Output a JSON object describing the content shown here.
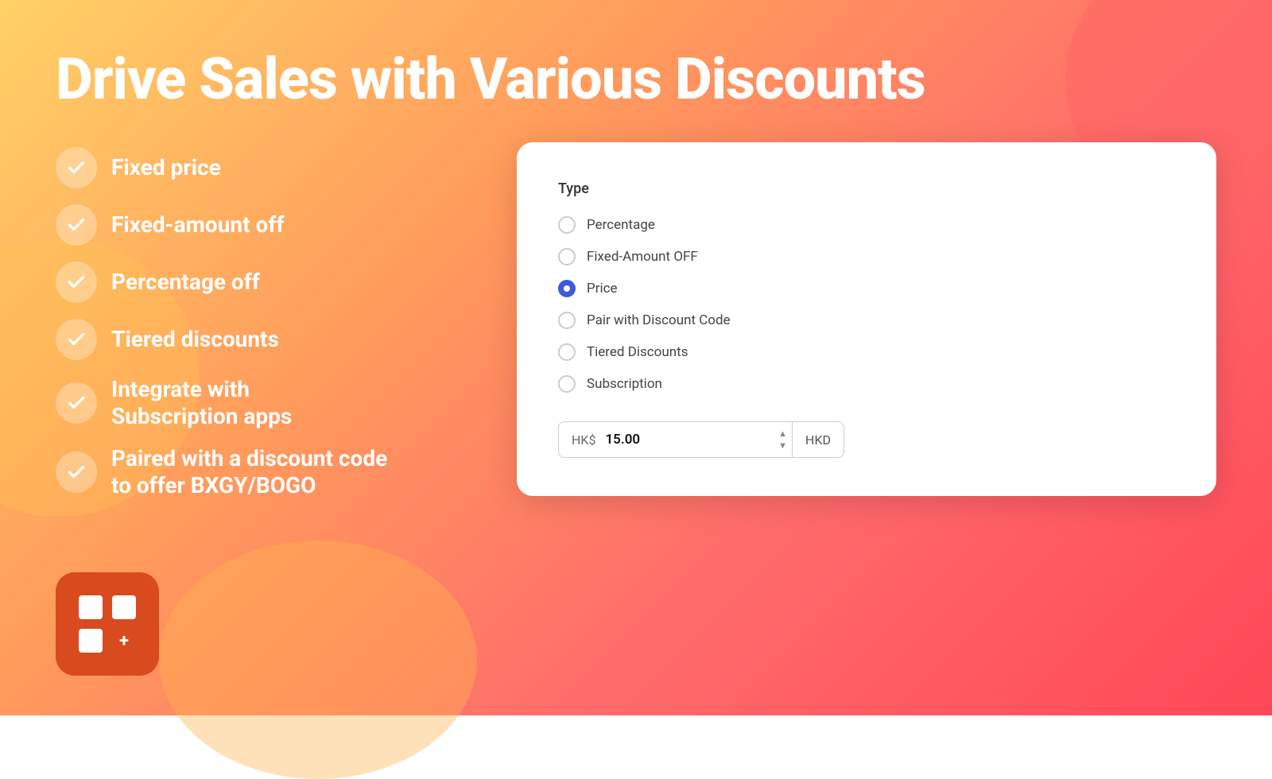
{
  "background": {
    "gradient_start": "#FFD166",
    "gradient_end": "#FF4757"
  },
  "title": "Drive Sales with Various Discounts",
  "checklist": {
    "items": [
      {
        "id": "fixed-price",
        "label": "Fixed price"
      },
      {
        "id": "fixed-amount-off",
        "label": "Fixed-amount off"
      },
      {
        "id": "percentage-off",
        "label": "Percentage off"
      },
      {
        "id": "tiered-discounts",
        "label": "Tiered discounts"
      },
      {
        "id": "integrate-subscription",
        "label": "Integrate with\nSubscription apps"
      },
      {
        "id": "paired-discount",
        "label": "Paired with a discount code\nto offer BXGY/BOGO"
      }
    ]
  },
  "card": {
    "type_label": "Type",
    "radio_options": [
      {
        "id": "percentage",
        "label": "Percentage",
        "selected": false
      },
      {
        "id": "fixed-amount-off",
        "label": "Fixed-Amount OFF",
        "selected": false
      },
      {
        "id": "price",
        "label": "Price",
        "selected": true
      },
      {
        "id": "pair-discount-code",
        "label": "Pair with Discount Code",
        "selected": false
      },
      {
        "id": "tiered-discounts",
        "label": "Tiered Discounts",
        "selected": false
      },
      {
        "id": "subscription",
        "label": "Subscription",
        "selected": false
      }
    ],
    "price_prefix": "HK$",
    "price_value": "15.00",
    "price_currency": "HKD"
  },
  "app_icon": {
    "aria": "App icon"
  }
}
